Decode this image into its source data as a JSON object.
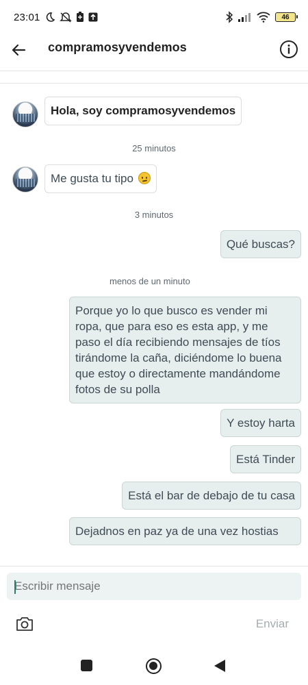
{
  "status_bar": {
    "time": "23:01",
    "battery": "46",
    "icons_left": [
      "moon-icon",
      "mute-icon",
      "battery-saver-icon",
      "upload-icon"
    ],
    "icons_right": [
      "bluetooth-icon",
      "signal-icon",
      "wifi-icon",
      "battery-icon"
    ]
  },
  "header": {
    "title": "compramosyvendemos",
    "back_icon": "back-arrow-icon",
    "info_icon": "info-icon"
  },
  "messages": [
    {
      "direction": "in",
      "text": "Hola, soy compramosyvendemos",
      "style": "bold"
    },
    {
      "type": "timestamp",
      "text": "25 minutos"
    },
    {
      "direction": "in",
      "text": "Me gusta tu tipo",
      "emoji": "slightly-smiling-face-icon"
    },
    {
      "type": "timestamp",
      "text": "3 minutos"
    },
    {
      "direction": "out",
      "text": "Qué buscas?"
    },
    {
      "type": "timestamp",
      "text": "menos de un minuto"
    },
    {
      "direction": "out",
      "text": "Porque yo lo que busco es vender mi ropa, que para eso es esta app, y me paso el día recibiendo mensajes de tíos tirándome la caña, diciéndome lo buena que estoy o directamente mandándome fotos de su polla"
    },
    {
      "direction": "out",
      "text": "Y estoy harta"
    },
    {
      "direction": "out",
      "text": "Está Tinder"
    },
    {
      "direction": "out",
      "text": "Está el bar de debajo de tu casa"
    },
    {
      "direction": "out",
      "text": "Dejadnos en paz ya de una vez hostias"
    }
  ],
  "composer": {
    "placeholder": "Escribir mensaje",
    "send_label": "Enviar",
    "camera_icon": "camera-icon"
  },
  "colors": {
    "outgoing_bubble": "#e6efee",
    "outgoing_border": "#c9d6d4",
    "input_background": "#edf3f2",
    "accent": "#2e7d6b"
  }
}
